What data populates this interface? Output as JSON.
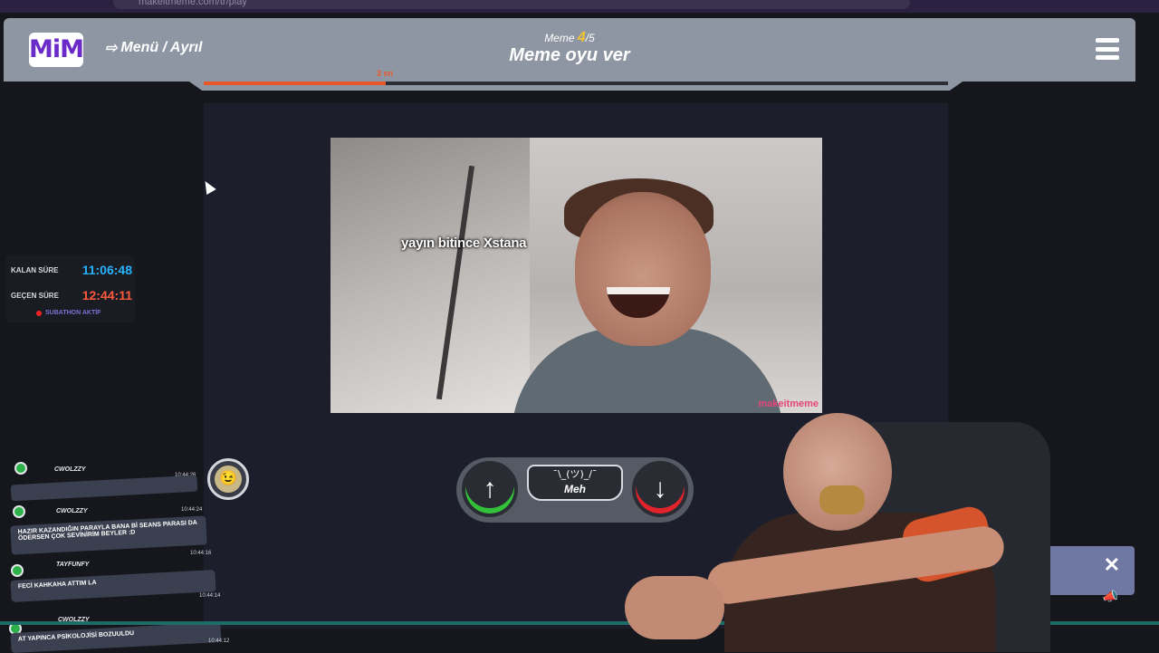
{
  "browser": {
    "url": "makeitmeme.com/tr/play"
  },
  "header": {
    "logo_text": "MiM",
    "menu_link": "Menü / Ayrıl",
    "meme_label": "Meme",
    "meme_current": "4",
    "meme_total": "/5",
    "title": "Meme oyu ver"
  },
  "progress": {
    "label": "3 sn",
    "fraction": 0.245
  },
  "meme": {
    "caption": "yayın bitince Xstana",
    "watermark": "makeitmeme"
  },
  "vote": {
    "up_icon": "↑",
    "down_icon": "↓",
    "meh_kaomoji": "¯\\_(ツ)_/¯",
    "meh_label": "Meh"
  },
  "timers": {
    "remaining_label": "KALAN SÜRE",
    "remaining_value": "11:06:48",
    "elapsed_label": "GEÇEN SÜRE",
    "elapsed_value": "12:44:11",
    "status": "SUBATHON AKTİF"
  },
  "chat": [
    {
      "user": "CWOLZZY",
      "time": "10:44:26",
      "text": ""
    },
    {
      "user": "CWOLZZY",
      "time": "10:44:24",
      "text": "HAZIR KAZANDIĞIN PARAYLA BANA Bİ SEANS PARASI DA ÖDERSEN ÇOK SEVİNİRİM BEYLER :D"
    },
    {
      "user": "TAYFUNFY",
      "time": "10:44:16",
      "text": "FECİ KAHKAHA ATTIM LA"
    },
    {
      "user": "CWOLZZY",
      "time": "10:44:14",
      "text": "AT YAPINCA PSİKOLOJİSİ BOZUULDU"
    },
    {
      "user": "",
      "time": "10:44:12",
      "text": ""
    }
  ],
  "toast": {
    "close_icon": "✕",
    "megaphone_icon": "📣"
  }
}
